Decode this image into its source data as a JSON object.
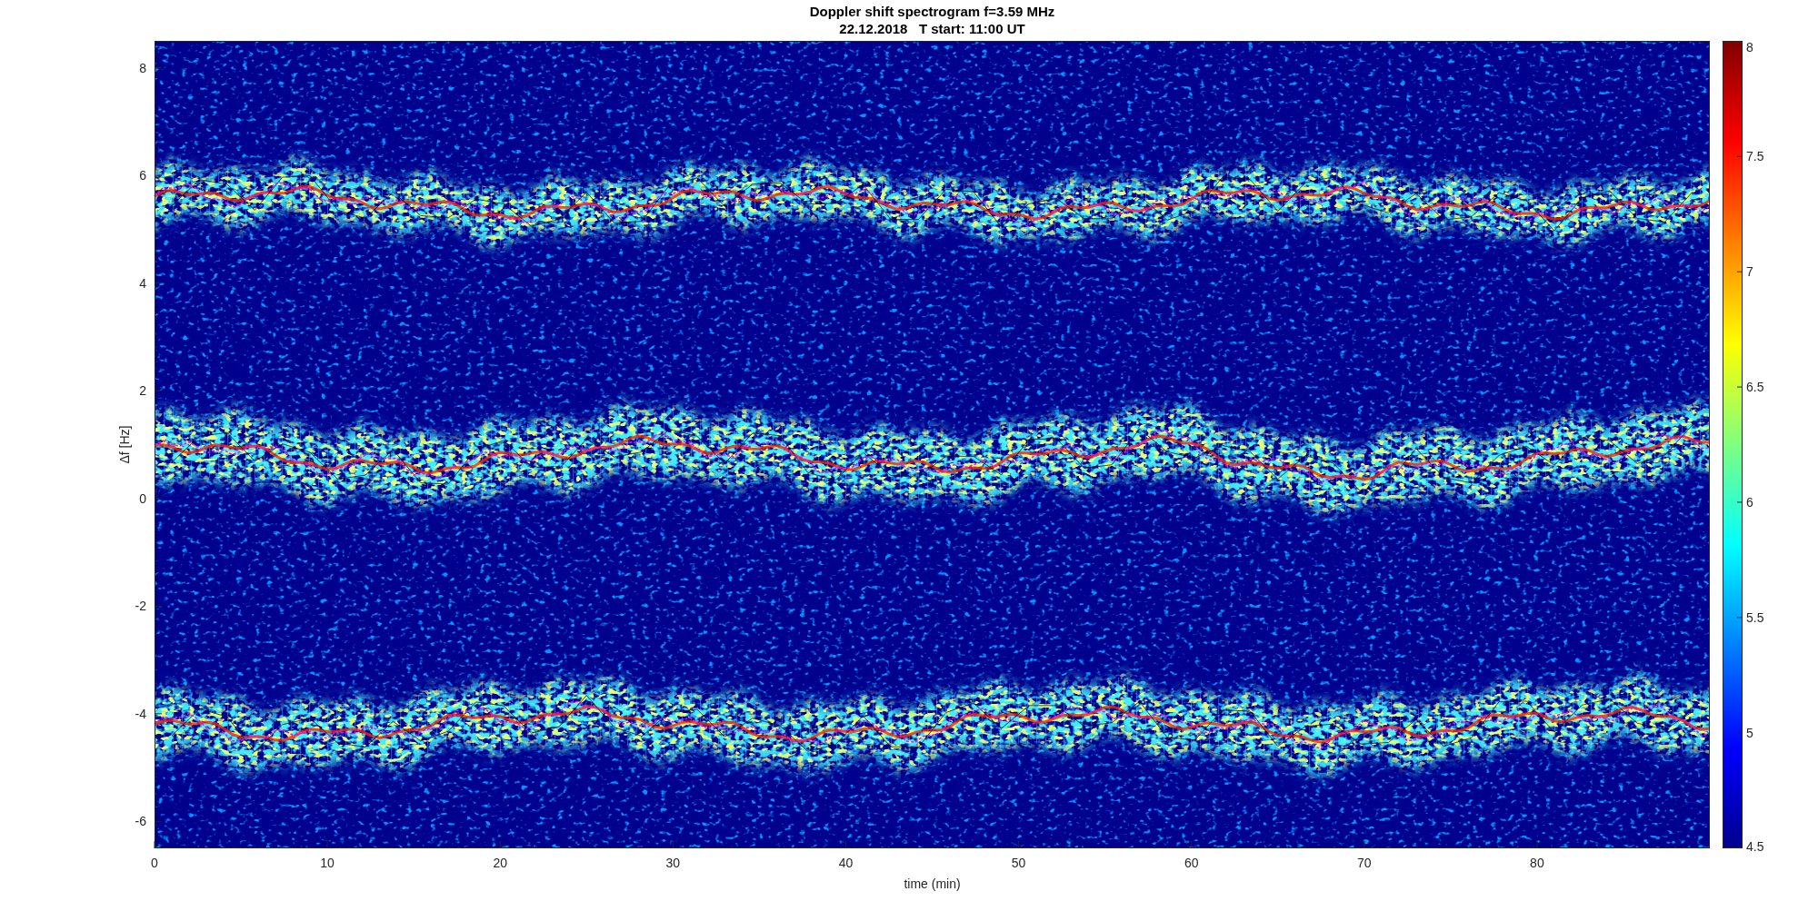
{
  "figure": {
    "title": [
      "Doppler shift spectrogram f=3.59 MHz",
      "22.12.2018   T start: 11:00 UT"
    ],
    "x_axis": {
      "label": "time (min)",
      "ticks": [
        "0",
        "10",
        "20",
        "30",
        "40",
        "50",
        "60",
        "70",
        "80"
      ]
    },
    "y_axis": {
      "label": "Δf [Hz]",
      "ticks": [
        "8",
        "6",
        "4",
        "2",
        "0",
        "-2",
        "-4",
        "-6"
      ]
    },
    "colorbar": {
      "ticks": [
        "8",
        "7.5",
        "7",
        "6.5",
        "6",
        "5.5",
        "5",
        "4.5"
      ]
    }
  }
}
